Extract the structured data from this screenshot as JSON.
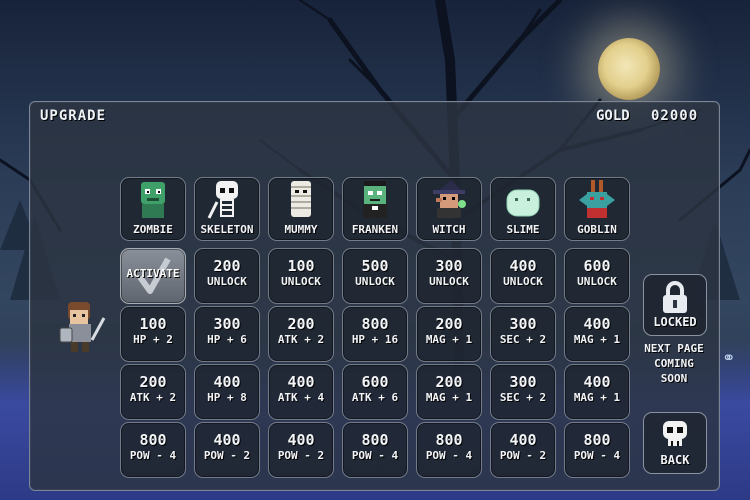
{
  "header": {
    "title": "UPGRADE",
    "gold_label": "GOLD",
    "gold_value": "02000"
  },
  "monsters": [
    {
      "name": "ZOMBIE",
      "icon": "zombie-icon"
    },
    {
      "name": "SKELETON",
      "icon": "skeleton-icon"
    },
    {
      "name": "MUMMY",
      "icon": "mummy-icon"
    },
    {
      "name": "FRANKEN",
      "icon": "franken-icon"
    },
    {
      "name": "WITCH",
      "icon": "witch-icon"
    },
    {
      "name": "SLIME",
      "icon": "slime-icon"
    },
    {
      "name": "GOBLIN",
      "icon": "goblin-icon"
    }
  ],
  "unlock_row": [
    {
      "activate": "ACTIVATE"
    },
    {
      "cost": "200",
      "label": "UNLOCK"
    },
    {
      "cost": "100",
      "label": "UNLOCK"
    },
    {
      "cost": "500",
      "label": "UNLOCK"
    },
    {
      "cost": "300",
      "label": "UNLOCK"
    },
    {
      "cost": "400",
      "label": "UNLOCK"
    },
    {
      "cost": "600",
      "label": "UNLOCK"
    }
  ],
  "upgrade_rows": [
    [
      {
        "cost": "100",
        "label": "HP + 2"
      },
      {
        "cost": "300",
        "label": "HP + 6"
      },
      {
        "cost": "200",
        "label": "ATK + 2"
      },
      {
        "cost": "800",
        "label": "HP + 16"
      },
      {
        "cost": "200",
        "label": "MAG + 1"
      },
      {
        "cost": "300",
        "label": "SEC + 2"
      },
      {
        "cost": "400",
        "label": "MAG + 1"
      }
    ],
    [
      {
        "cost": "200",
        "label": "ATK + 2"
      },
      {
        "cost": "400",
        "label": "HP + 8"
      },
      {
        "cost": "400",
        "label": "ATK + 4"
      },
      {
        "cost": "600",
        "label": "ATK + 6"
      },
      {
        "cost": "200",
        "label": "MAG + 1"
      },
      {
        "cost": "300",
        "label": "SEC + 2"
      },
      {
        "cost": "400",
        "label": "MAG + 1"
      }
    ],
    [
      {
        "cost": "800",
        "label": "POW - 4"
      },
      {
        "cost": "400",
        "label": "POW - 2"
      },
      {
        "cost": "400",
        "label": "POW - 2"
      },
      {
        "cost": "800",
        "label": "POW - 4"
      },
      {
        "cost": "800",
        "label": "POW - 4"
      },
      {
        "cost": "400",
        "label": "POW - 2"
      },
      {
        "cost": "800",
        "label": "POW - 4"
      }
    ]
  ],
  "side": {
    "locked_label": "LOCKED",
    "next_page_line1": "NEXT PAGE",
    "next_page_line2": "COMING",
    "next_page_line3": "SOON",
    "back_label": "BACK"
  },
  "colors": {
    "panel": "#2c3442",
    "accent_moon": "#e2cf8c",
    "zombie_green": "#3fa06a"
  }
}
